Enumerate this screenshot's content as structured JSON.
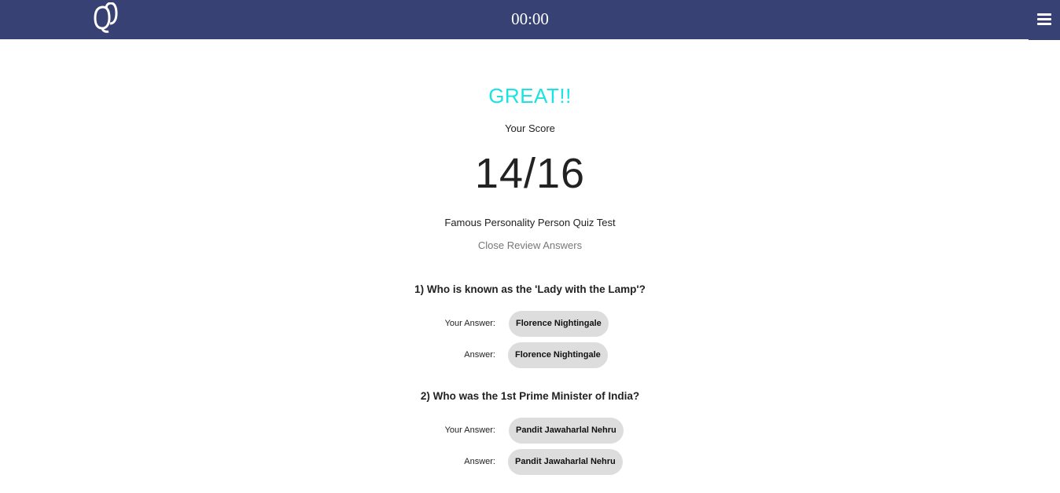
{
  "header": {
    "logo_icon": "quiz-logo-icon",
    "timer": "00:00",
    "menu_icon": "hamburger-menu-icon",
    "bar_color": "#374174"
  },
  "result": {
    "headline": "GREAT!!",
    "headline_color": "#19e3e3",
    "score_label": "Your Score",
    "score": "14/16",
    "quiz_title": "Famous Personality Person Quiz Test",
    "review_toggle": "Close Review Answers"
  },
  "review": [
    {
      "question": "1) Who is known as the 'Lady with the Lamp'?",
      "your_answer_label": "Your Answer:",
      "your_answer": "Florence Nightingale",
      "answer_label": "Answer:",
      "answer": "Florence Nightingale"
    },
    {
      "question": "2) Who was the 1st Prime Minister of India?",
      "your_answer_label": "Your Answer:",
      "your_answer": "Pandit Jawaharlal Nehru",
      "answer_label": "Answer:",
      "answer": "Pandit Jawaharlal Nehru"
    }
  ]
}
